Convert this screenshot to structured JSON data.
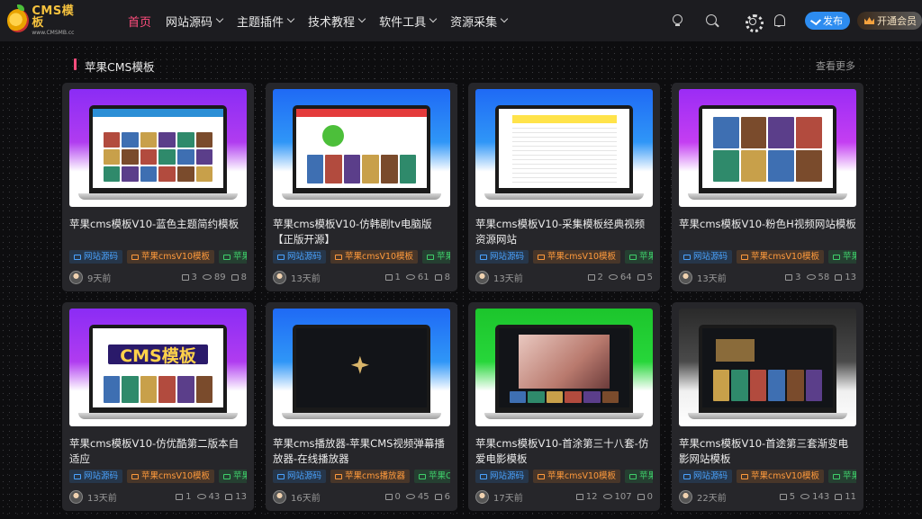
{
  "header": {
    "logo_title": "CMS模板",
    "logo_sub": "www.CMSMB.cc",
    "nav": [
      {
        "label": "首页"
      },
      {
        "label": "网站源码"
      },
      {
        "label": "主题插件"
      },
      {
        "label": "技术教程"
      },
      {
        "label": "软件工具"
      },
      {
        "label": "资源采集"
      }
    ],
    "publish_label": "发布",
    "vip_label": "开通会员"
  },
  "section": {
    "title": "苹果CMS模板",
    "more_label": "查看更多"
  },
  "cards": [
    {
      "title": "苹果cms模板V10-蓝色主题简约模板",
      "tags": [
        "网站源码",
        "苹果cmsV10模板",
        "苹果CMS"
      ],
      "time": "9天前",
      "comments": "3",
      "views": "89",
      "likes": "8"
    },
    {
      "title": "苹果cms模板V10-仿韩剧tv电脑版【正版开源】",
      "tags": [
        "网站源码",
        "苹果cmsV10模板",
        "苹果CMS"
      ],
      "time": "13天前",
      "comments": "1",
      "views": "61",
      "likes": "8"
    },
    {
      "title": "苹果cms模板V10-采集模板经典视频资源网站",
      "tags": [
        "网站源码",
        "苹果cmsV10模板",
        "苹果CMS"
      ],
      "time": "13天前",
      "comments": "2",
      "views": "64",
      "likes": "5"
    },
    {
      "title": "苹果cms模板V10-粉色H视频网站模板",
      "tags": [
        "网站源码",
        "苹果cmsV10模板",
        "苹果CMS"
      ],
      "time": "13天前",
      "comments": "3",
      "views": "58",
      "likes": "13"
    },
    {
      "title": "苹果cms模板V10-仿优酷第二版本自适应",
      "tags": [
        "网站源码",
        "苹果cmsV10模板",
        "苹果CMS"
      ],
      "time": "13天前",
      "comments": "1",
      "views": "43",
      "likes": "13"
    },
    {
      "title": "苹果cms播放器-苹果CMS视频弹幕播放器-在线播放器",
      "tags": [
        "网站源码",
        "苹果cms播放器",
        "苹果CMS"
      ],
      "time": "16天前",
      "comments": "0",
      "views": "45",
      "likes": "6"
    },
    {
      "title": "苹果cms模板V10-首涂第三十八套-仿爱电影模板",
      "tags": [
        "网站源码",
        "苹果cmsV10模板",
        "苹果CMS"
      ],
      "time": "17天前",
      "comments": "12",
      "views": "107",
      "likes": "0"
    },
    {
      "title": "苹果cms模板V10-首途第三套渐变电影网站模板",
      "tags": [
        "网站源码",
        "苹果cmsV10模板",
        "苹果CMS"
      ],
      "time": "22天前",
      "comments": "5",
      "views": "143",
      "likes": "11"
    }
  ],
  "thumb_text": {
    "cms_badge": "CMS模板"
  }
}
